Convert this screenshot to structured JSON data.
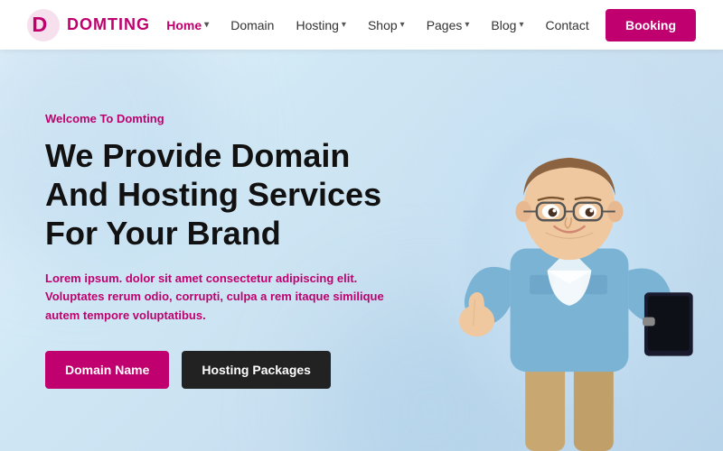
{
  "brand": {
    "name": "DOMTING",
    "logo_letter": "D"
  },
  "nav": {
    "links": [
      {
        "label": "Home",
        "active": true,
        "has_dropdown": true
      },
      {
        "label": "Domain",
        "active": false,
        "has_dropdown": false
      },
      {
        "label": "Hosting",
        "active": false,
        "has_dropdown": true
      },
      {
        "label": "Shop",
        "active": false,
        "has_dropdown": true
      },
      {
        "label": "Pages",
        "active": false,
        "has_dropdown": true
      },
      {
        "label": "Blog",
        "active": false,
        "has_dropdown": true
      },
      {
        "label": "Contact",
        "active": false,
        "has_dropdown": false
      }
    ],
    "booking_label": "Booking"
  },
  "hero": {
    "welcome": "Welcome To Domting",
    "title_line1": "We Provide Domain",
    "title_line2": "And Hosting Services",
    "title_line3": "For Your Brand",
    "description_bold": "Lorem ipsum. dolor sit amet consectetur adipiscing elit. Voluptates rerum",
    "description_rest": "odio, corrupti, culpa a rem itaque similique autem tempore voluptatibus.",
    "btn_domain": "Domain Name",
    "btn_hosting": "Hosting Packages"
  }
}
